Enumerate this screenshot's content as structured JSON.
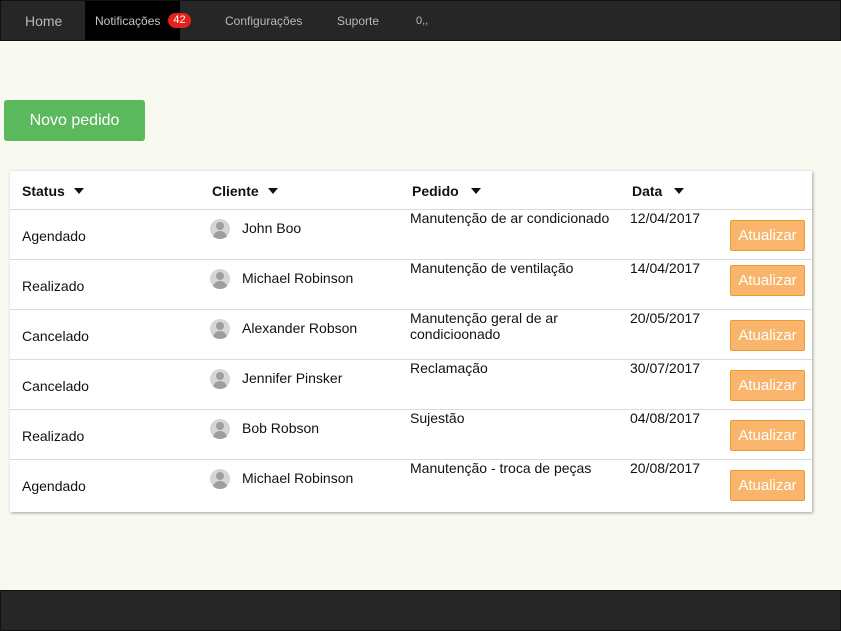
{
  "nav": {
    "home": "Home",
    "notifications": "Notificações",
    "notifications_count": "42",
    "settings": "Configurações",
    "support": "Suporte",
    "extra": "0,,"
  },
  "actions": {
    "new_order": "Novo pedido"
  },
  "table": {
    "headers": {
      "status": "Status",
      "client": "Cliente",
      "order": "Pedido",
      "date": "Data"
    },
    "update_label": "Atualizar",
    "rows": [
      {
        "status": "Agendado",
        "client": "John Boo",
        "order": "Manutenção de ar condicionado",
        "date": "12/04/2017"
      },
      {
        "status": "Realizado",
        "client": "Michael Robinson",
        "order": "Manutenção de ventilação",
        "date": "14/04/2017"
      },
      {
        "status": "Cancelado",
        "client": "Alexander Robson",
        "order": "Manutenção geral de ar condicioonado",
        "date": "20/05/2017"
      },
      {
        "status": "Cancelado",
        "client": "Jennifer Pinsker",
        "order": "Reclamação",
        "date": "30/07/2017"
      },
      {
        "status": "Realizado",
        "client": "Bob Robson",
        "order": "Sujestão",
        "date": "04/08/2017"
      },
      {
        "status": "Agendado",
        "client": "Michael Robinson",
        "order": "Manutenção - troca de peças",
        "date": "20/08/2017"
      }
    ]
  },
  "colors": {
    "navbar": "#262626",
    "background": "#f8f9f1",
    "primary_button": "#5cb85c",
    "update_button": "#f9b56b",
    "badge": "#e5211d"
  }
}
